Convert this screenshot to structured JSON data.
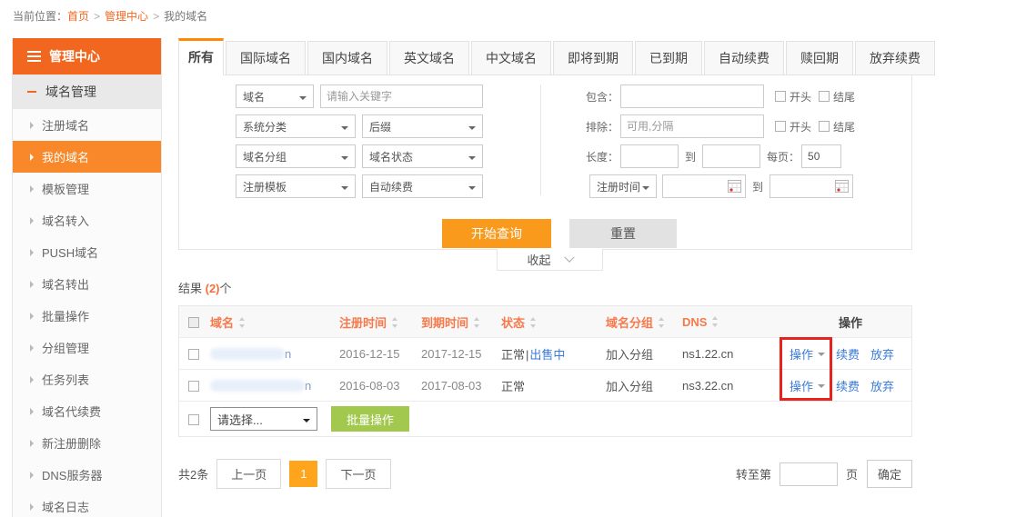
{
  "breadcrumb": {
    "label": "当前位置：",
    "home": "首页",
    "center": "管理中心",
    "current": "我的域名",
    "separator": ">"
  },
  "sidebar": {
    "header": "管理中心",
    "section": "域名管理",
    "items": [
      "注册域名",
      "我的域名",
      "模板管理",
      "域名转入",
      "PUSH域名",
      "域名转出",
      "批量操作",
      "分组管理",
      "任务列表",
      "域名代续费",
      "新注册删除",
      "DNS服务器",
      "域名日志"
    ],
    "active_item": "我的域名"
  },
  "tabs": [
    "所有",
    "国际域名",
    "国内域名",
    "英文域名",
    "中文域名",
    "即将到期",
    "已到期",
    "自动续费",
    "赎回期",
    "放弃续费"
  ],
  "active_tab": "所有",
  "filters": {
    "field_select": "域名",
    "keyword_placeholder": "请输入关键字",
    "category_select": "系统分类",
    "suffix_select": "后缀",
    "group_select": "域名分组",
    "status_select": "域名状态",
    "template_select": "注册模板",
    "autorenew_select": "自动续费",
    "contains_label": "包含：",
    "exclude_label": "排除：",
    "exclude_placeholder": "可用,分隔",
    "length_label": "长度：",
    "to_label": "到",
    "per_page_label": "每页：",
    "per_page_value": "50",
    "starts_label": "开头",
    "ends_label": "结尾",
    "time_field_select": "注册时间"
  },
  "actions": {
    "search": "开始查询",
    "reset": "重置",
    "collapse": "收起"
  },
  "results": {
    "prefix": "结果 ",
    "count": "(2)",
    "suffix": "个"
  },
  "table": {
    "h_domain": "域名",
    "h_reg": "注册时间",
    "h_exp": "到期时间",
    "h_status": "状态",
    "h_group": "域名分组",
    "h_dns": "DNS",
    "h_action": "操作",
    "rows": [
      {
        "domain_tail": "n",
        "reg": "2016-12-15",
        "exp": "2017-12-15",
        "status": "正常",
        "status_sep": "|",
        "status_link": "出售中",
        "group": "加入分组",
        "dns": "ns1.22.cn",
        "op": "操作",
        "renew": "续费",
        "abandon": "放弃"
      },
      {
        "domain_tail": "n",
        "reg": "2016-08-03",
        "exp": "2017-08-03",
        "status": "正常",
        "group": "加入分组",
        "dns": "ns3.22.cn",
        "op": "操作",
        "renew": "续费",
        "abandon": "放弃"
      }
    ]
  },
  "batch": {
    "select": "请选择...",
    "button": "批量操作"
  },
  "pagination": {
    "total": "共2条",
    "prev": "上一页",
    "current": "1",
    "next": "下一页",
    "goto_label": "转至第",
    "page_label": "页",
    "confirm": "确定"
  },
  "icons": {
    "menu": "hamburger-icon",
    "calendar": "calendar-icon",
    "sort": "sort-arrows-icon",
    "chevron": "chevron-down-icon"
  },
  "colors": {
    "brand_orange": "#f2671f",
    "button_orange": "#fa9a1c",
    "active_page_orange": "#ffa41d",
    "link_blue": "#3a7bd8",
    "batch_green": "#a2c94e",
    "annotation_red": "#e8231d",
    "table_header_orange": "#f7794b"
  }
}
